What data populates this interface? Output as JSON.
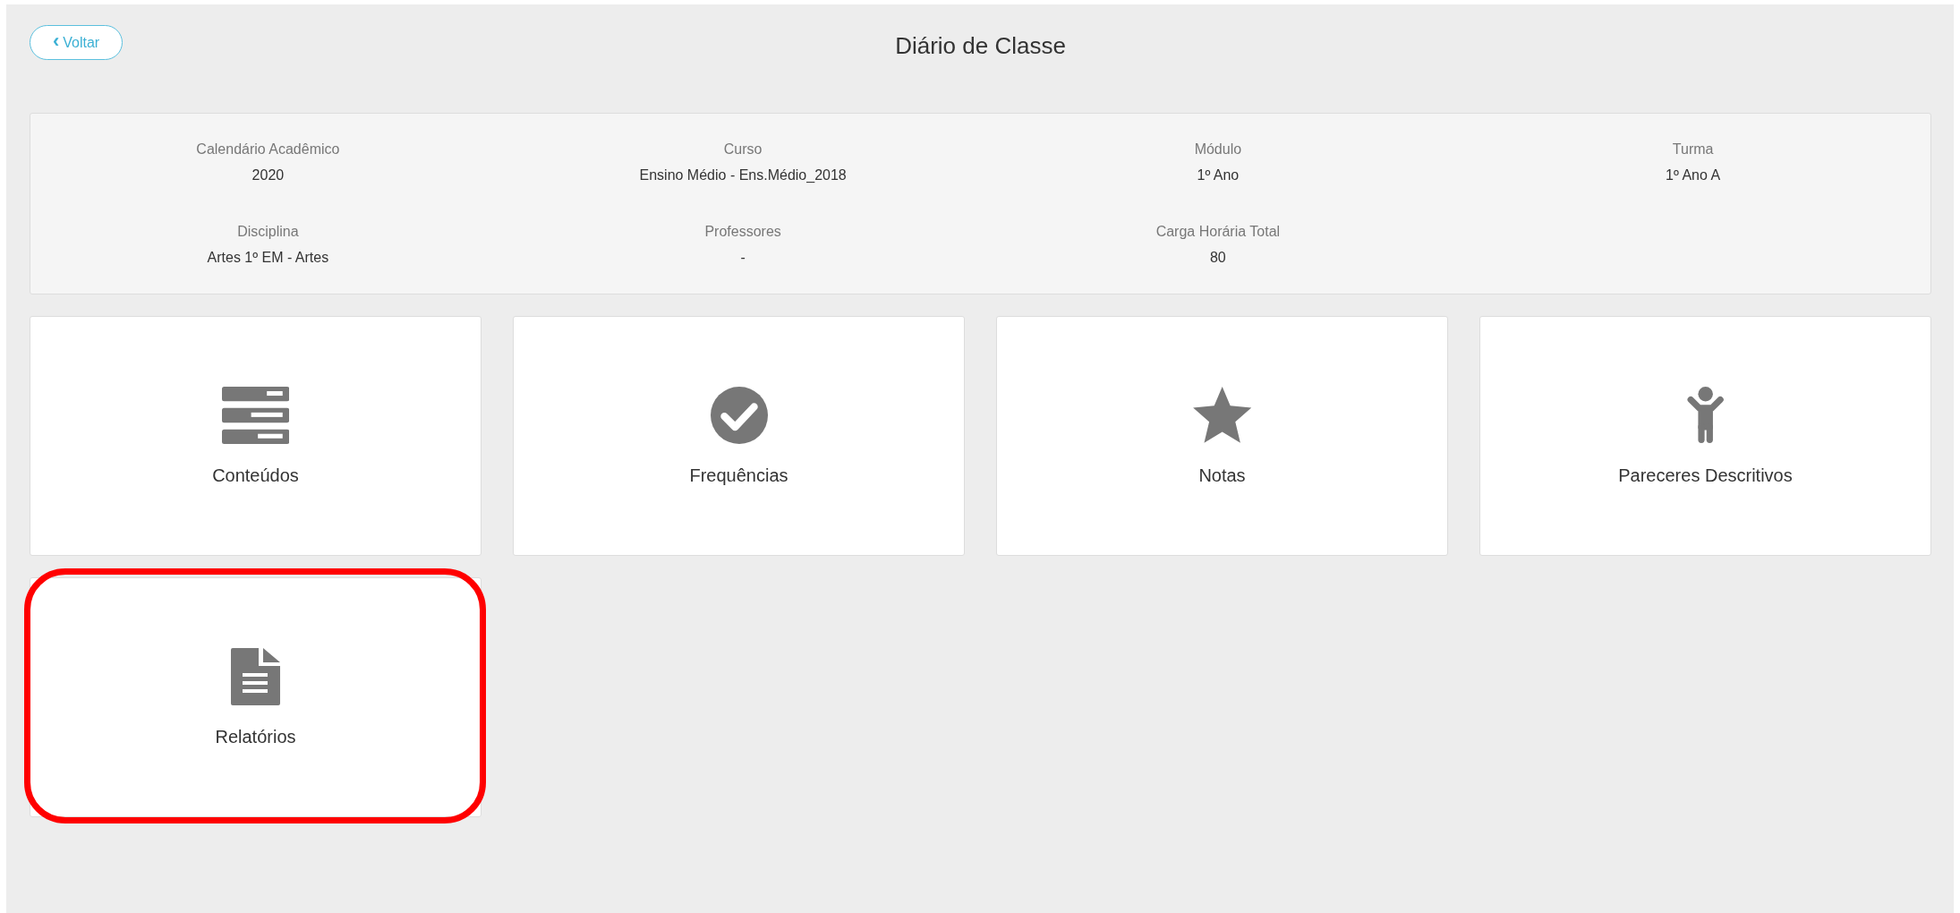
{
  "back_button": {
    "icon": "‹",
    "label": "Voltar"
  },
  "title": "Diário de Classe",
  "info": [
    {
      "label": "Calendário Acadêmico",
      "value": "2020"
    },
    {
      "label": "Curso",
      "value": "Ensino Médio - Ens.Médio_2018"
    },
    {
      "label": "Módulo",
      "value": "1º Ano"
    },
    {
      "label": "Turma",
      "value": "1º Ano A"
    },
    {
      "label": "Disciplina",
      "value": "Artes 1º EM - Artes"
    },
    {
      "label": "Professores",
      "value": "-"
    },
    {
      "label": "Carga Horária Total",
      "value": "80"
    }
  ],
  "cards": [
    {
      "label": "Conteúdos",
      "highlighted": false
    },
    {
      "label": "Frequências",
      "highlighted": false
    },
    {
      "label": "Notas",
      "highlighted": false
    },
    {
      "label": "Pareceres Descritivos",
      "highlighted": false
    },
    {
      "label": "Relatórios",
      "highlighted": true
    }
  ]
}
